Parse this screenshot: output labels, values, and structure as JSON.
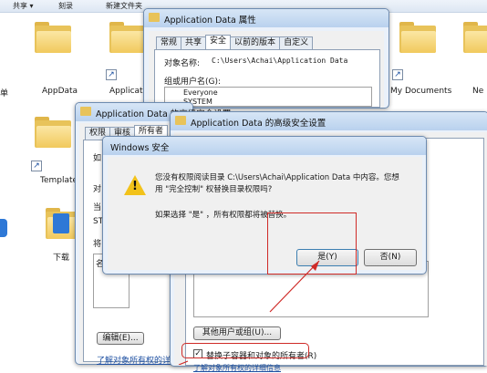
{
  "explorer": {
    "toolbar": [
      "共享 ▾",
      "刻录",
      "新建文件夹"
    ],
    "folders": [
      "AppData",
      "Applicati",
      "My Documents",
      "Ne",
      "Template",
      "下载",
      "单"
    ]
  },
  "props_window": {
    "title": "Application Data 属性",
    "tabs": [
      "常规",
      "共享",
      "安全",
      "以前的版本",
      "自定义"
    ],
    "object_label": "对象名称:",
    "object_value": "C:\\Users\\Achai\\Application Data",
    "group_label": "组或用户名(G):",
    "users": [
      "Everyone",
      "SYSTEM"
    ]
  },
  "adv_window_back": {
    "title": "Application Data 的高级安全设置",
    "tabs": [
      "权限",
      "审核",
      "所有者"
    ],
    "labels": [
      "如",
      "对",
      "当",
      "ST",
      "将",
      "名"
    ]
  },
  "adv_window_front": {
    "title": "Application Data 的高级安全设置",
    "edit_button": "编辑(E)...",
    "other_users_button": "其他用户或组(U)...",
    "replace_checkbox": "替换子容器和对象的所有者(R)",
    "link": "了解对象所有权的详细",
    "link2": "了解对象所有权的详细信息"
  },
  "dialog": {
    "title": "Windows 安全",
    "message_line1": "您没有权限阅读目录 C:\\Users\\Achai\\Application Data 中内容。您想",
    "message_line2": "用 \"完全控制\" 权替换目录权限吗?",
    "message_line3": "如果选择 \"是\" ，所有权限都将被替换。",
    "yes_button": "是(Y)",
    "no_button": "否(N)"
  },
  "colors": {
    "highlight": "#cf2a27",
    "warning": "#f2c21a"
  }
}
